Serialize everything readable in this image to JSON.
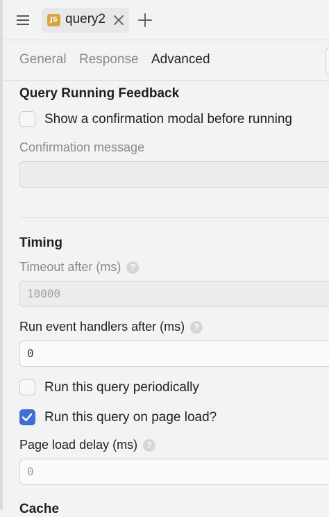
{
  "topbar": {
    "tab_badge": "JS",
    "tab_label": "query2"
  },
  "subtabs": [
    "General",
    "Response",
    "Advanced"
  ],
  "feedback": {
    "heading": "Query Running Feedback",
    "confirm_checkbox_label": "Show a confirmation modal before running",
    "confirm_checkbox_checked": false,
    "confirmation_message_label": "Confirmation message",
    "confirmation_message_value": ""
  },
  "timing": {
    "heading": "Timing",
    "timeout_label": "Timeout after (ms)",
    "timeout_placeholder": "10000",
    "run_handlers_label": "Run event handlers after (ms)",
    "run_handlers_value": "0",
    "periodic_label": "Run this query periodically",
    "periodic_checked": false,
    "page_load_label": "Run this query on page load?",
    "page_load_checked": true,
    "page_load_delay_label": "Page load delay (ms)",
    "page_load_delay_value": "0"
  },
  "cache": {
    "heading": "Cache"
  },
  "colors": {
    "accent": "#3f6fd6",
    "badge": "#d7a43e"
  },
  "help_icon_glyph": "?"
}
